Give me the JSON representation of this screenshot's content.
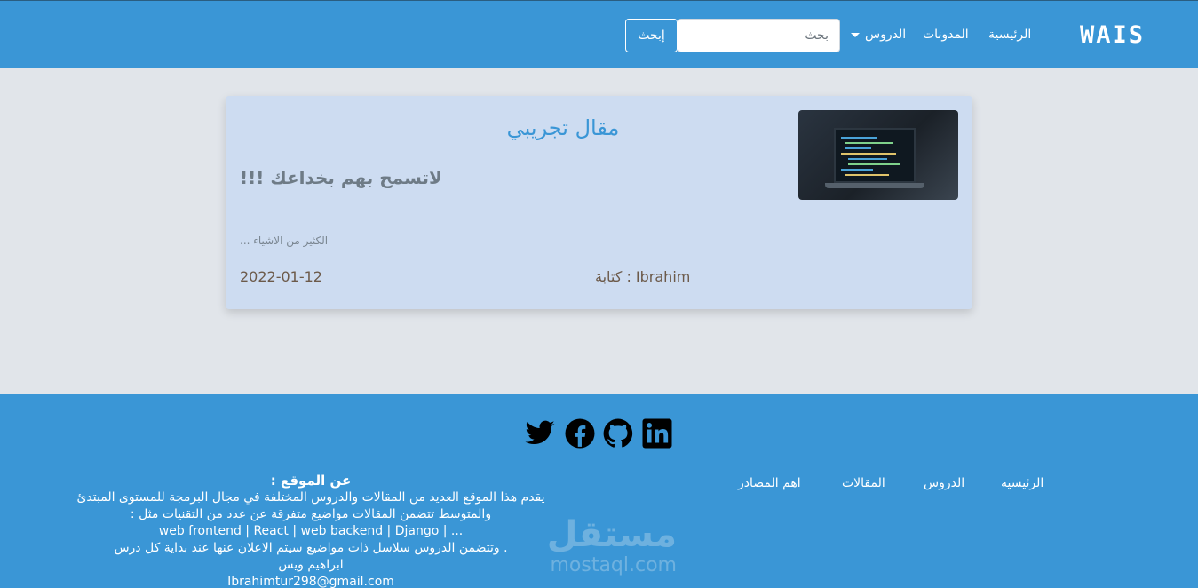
{
  "nav": {
    "brand": "WAIS",
    "home": "الرئيسية",
    "blogs": "المدونات",
    "courses": "الدروس",
    "search_placeholder": "بحث",
    "search_button": "إبحث"
  },
  "article": {
    "title": "مقال تجريبي",
    "subtitle": "لاتسمح بهم بخداعك !!!",
    "excerpt": "الكثير من الاشياء ...",
    "author": "كتابة : Ibrahim",
    "date": "2022-01-12"
  },
  "footer": {
    "social": [
      "twitter-icon",
      "facebook-icon",
      "github-icon",
      "linkedin-icon"
    ],
    "links": {
      "home": "الرئيسية",
      "courses": "الدروس",
      "articles": "المقالات",
      "sources": "اهم المصادر"
    },
    "about": {
      "title": "عن الموقع :",
      "line1": "يقدم هذا الموقع العديد من المقالات والدروس المختلفة في  مجال البرمجة للمستوى المبتدئ",
      "line2": "والمتوسط تتضمن المقالات مواضيع متفرقة عن عدد من التقنيات مثل :",
      "line3": "web frontend | React | web backend | Django | ...",
      "line4": ". وتتضمن الدروس سلاسل ذات مواضيع سيتم الاعلان عنها عند بداية كل درس",
      "line5": "ابراهيم ويس",
      "line6": "Ibrahimtur298@gmail.com"
    }
  },
  "watermark": {
    "arabic": "مستقل",
    "latin": "mostaql.com"
  },
  "colors": {
    "primary": "#3a96d6",
    "background": "#e1e5ea",
    "card": "#cddcf1"
  }
}
